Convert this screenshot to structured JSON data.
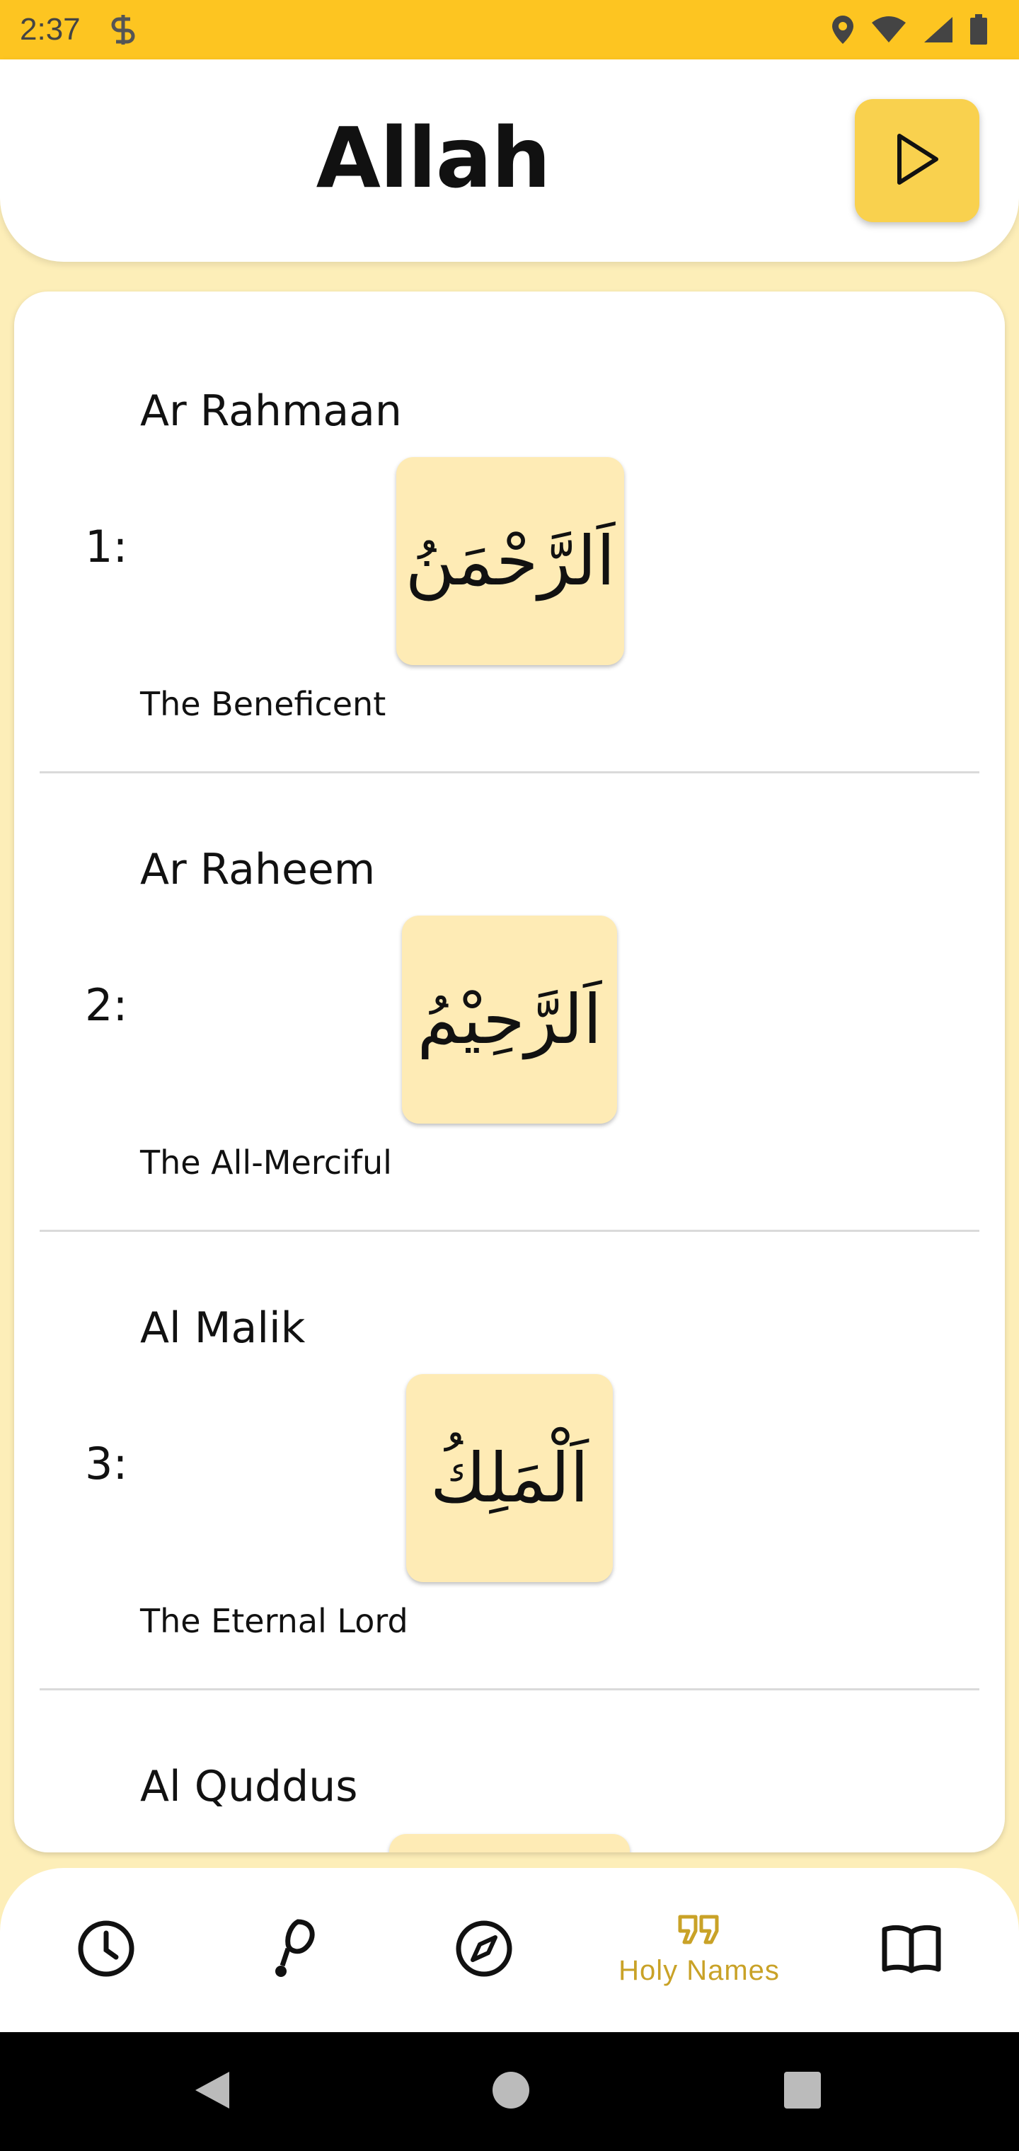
{
  "status_bar": {
    "time": "2:37"
  },
  "header": {
    "title": "Allah",
    "play_icon": "play-icon"
  },
  "names": [
    {
      "number": "1:",
      "transliteration": "Ar Rahmaan",
      "arabic": "اَلرَّحْمَنُ",
      "meaning": "The Beneficent"
    },
    {
      "number": "2:",
      "transliteration": "Ar Raheem",
      "arabic": "اَلرَّحِيْمُ",
      "meaning": "The All-Merciful"
    },
    {
      "number": "3:",
      "transliteration": "Al Malik",
      "arabic": "اَلْمَلِكُ",
      "meaning": "The Eternal Lord"
    },
    {
      "number": "",
      "transliteration": "Al Quddus",
      "arabic": "",
      "meaning": ""
    }
  ],
  "bottom_nav": {
    "items": [
      {
        "icon": "clock-icon",
        "label": ""
      },
      {
        "icon": "prayer-beads-icon",
        "label": ""
      },
      {
        "icon": "compass-icon",
        "label": ""
      },
      {
        "icon": "quote-icon",
        "label": "Holy Names",
        "active": true
      },
      {
        "icon": "book-icon",
        "label": ""
      }
    ]
  },
  "colors": {
    "status_bar": "#fdc521",
    "background": "#fdeeb8",
    "accent": "#f9d14e",
    "tile": "#feebb5",
    "active_nav": "#c9a227"
  }
}
